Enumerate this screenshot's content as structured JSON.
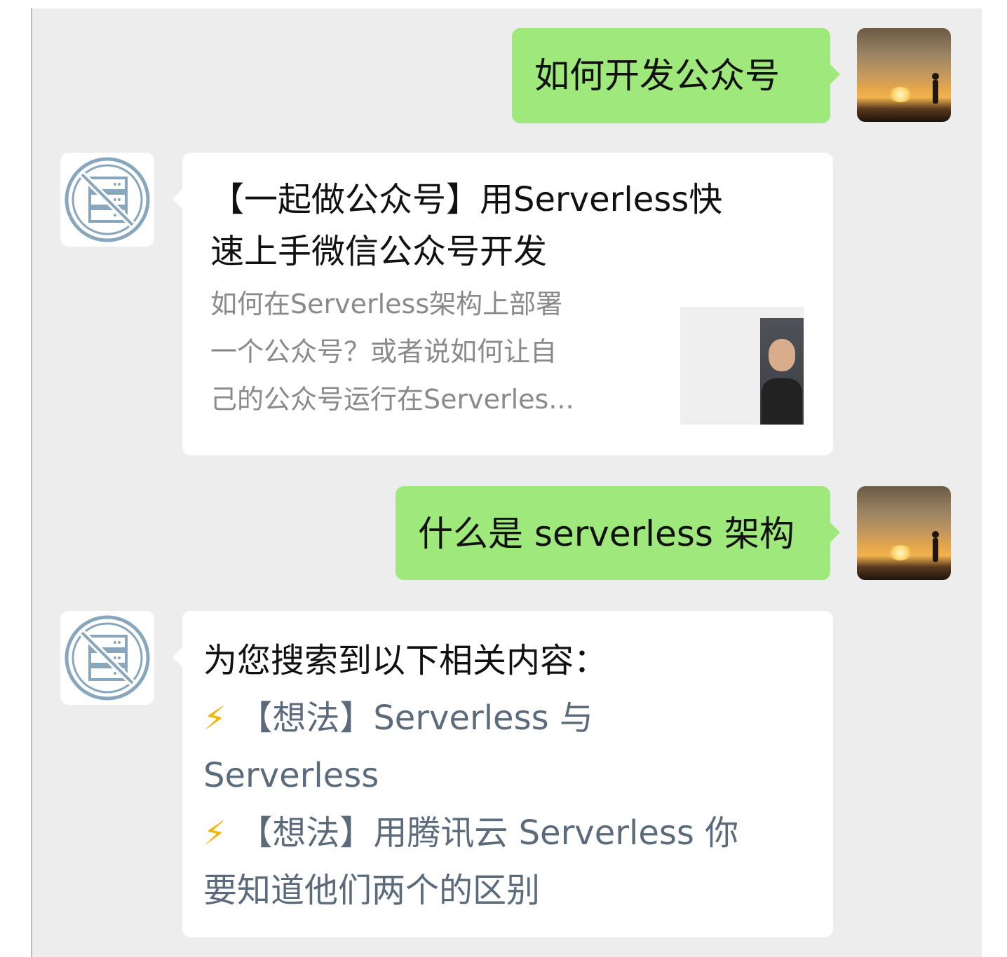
{
  "messages": [
    {
      "from": "user",
      "text": "如何开发公众号"
    },
    {
      "from": "bot",
      "card": {
        "title_line1": "【一起做公众号】用Serverless快",
        "title_line2": "速上手微信公众号开发",
        "desc_line1": "如何在Serverless架构上部署",
        "desc_line2": "一个公众号？或者说如何让自",
        "desc_line3": "己的公众号运行在Serverles..."
      }
    },
    {
      "from": "user",
      "text": "什么是 serverless 架构"
    },
    {
      "from": "bot",
      "intro": "为您搜索到以下相关内容：",
      "results": [
        {
          "icon": "⚡",
          "line1": "【想法】Serverless 与",
          "line2": "Serverless"
        },
        {
          "icon": "⚡",
          "line1": "【想法】用腾讯云 Serverless 你",
          "line2": "要知道他们两个的区别"
        }
      ]
    }
  ],
  "colors": {
    "background": "#ededed",
    "user_bubble": "#9fe87b",
    "bot_bubble": "#ffffff",
    "link_text": "#5b6b7c",
    "desc_text": "#8a8a8a",
    "bot_icon": "#88a7bd"
  }
}
